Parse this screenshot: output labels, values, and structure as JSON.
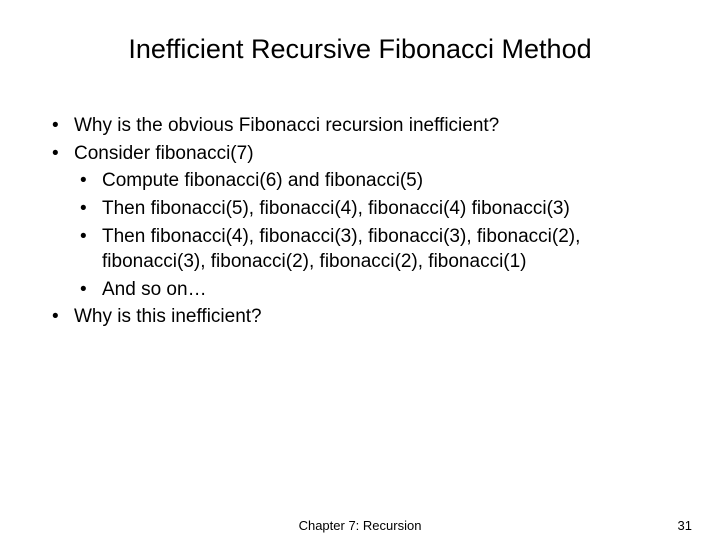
{
  "title": "Inefficient Recursive Fibonacci Method",
  "bullets": {
    "b1": "Why is the obvious Fibonacci recursion inefficient?",
    "b2": "Consider fibonacci(7)",
    "b2_1": "Compute fibonacci(6) and fibonacci(5)",
    "b2_2": "Then fibonacci(5), fibonacci(4), fibonacci(4) fibonacci(3)",
    "b2_3": "Then fibonacci(4), fibonacci(3), fibonacci(3), fibonacci(2), fibonacci(3), fibonacci(2), fibonacci(2), fibonacci(1)",
    "b2_4": "And so on…",
    "b3": "Why is this inefficient?"
  },
  "footer": {
    "center": "Chapter 7: Recursion",
    "page": "31"
  }
}
